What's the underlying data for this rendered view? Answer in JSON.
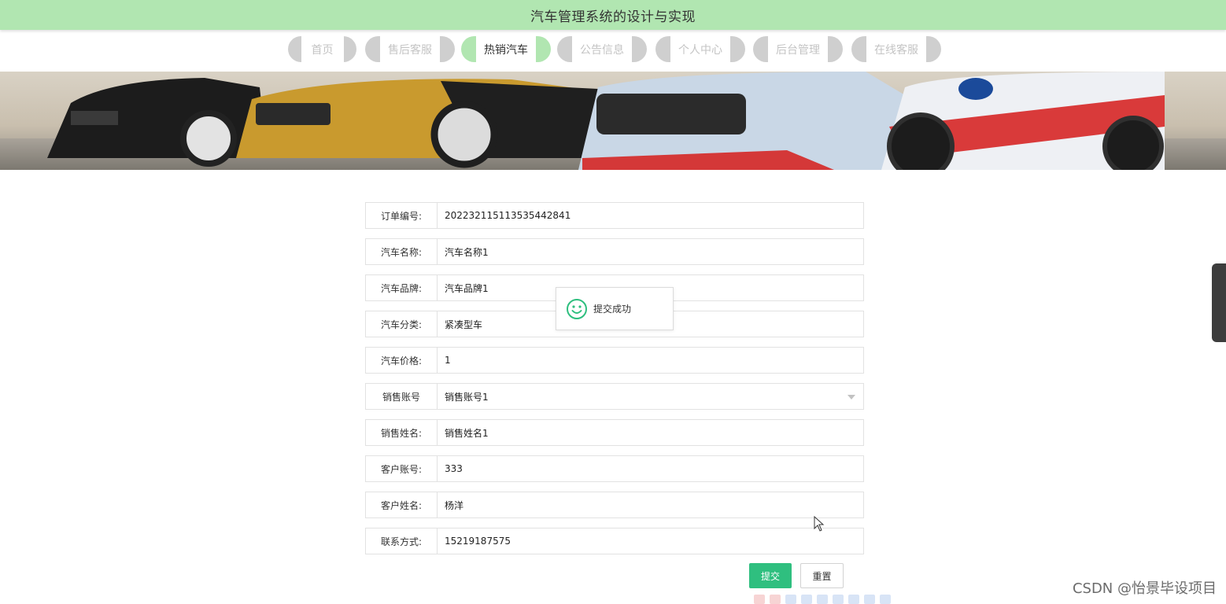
{
  "header": {
    "title": "汽车管理系统的设计与实现"
  },
  "nav": {
    "items": [
      {
        "label": "首页",
        "active": false
      },
      {
        "label": "售后客服",
        "active": false
      },
      {
        "label": "热销汽车",
        "active": true
      },
      {
        "label": "公告信息",
        "active": false
      },
      {
        "label": "个人中心",
        "active": false
      },
      {
        "label": "后台管理",
        "active": false
      },
      {
        "label": "在线客服",
        "active": false
      }
    ]
  },
  "form": {
    "fields": [
      {
        "label": "订单编号:",
        "value": "20223211511353544284​1"
      },
      {
        "label": "汽车名称:",
        "value": "汽车名称1"
      },
      {
        "label": "汽车品牌:",
        "value": "汽车品牌1"
      },
      {
        "label": "汽车分类:",
        "value": "紧凑型车"
      },
      {
        "label": "汽车价格:",
        "value": "1"
      },
      {
        "label": "销售账号",
        "value": "销售账号1"
      },
      {
        "label": "销售姓名:",
        "value": "销售姓名1"
      },
      {
        "label": "客户账号:",
        "value": "333"
      },
      {
        "label": "客户姓名:",
        "value": "杨洋"
      },
      {
        "label": "联系方式:",
        "value": "15219187575"
      }
    ],
    "submit_label": "提交",
    "reset_label": "重置"
  },
  "toast": {
    "message": "提交成功",
    "icon": "smile-icon"
  },
  "watermark": "CSDN @怡景毕设项目",
  "colors": {
    "accent_green": "#b1e6b1",
    "submit_green": "#2fbf7f"
  }
}
